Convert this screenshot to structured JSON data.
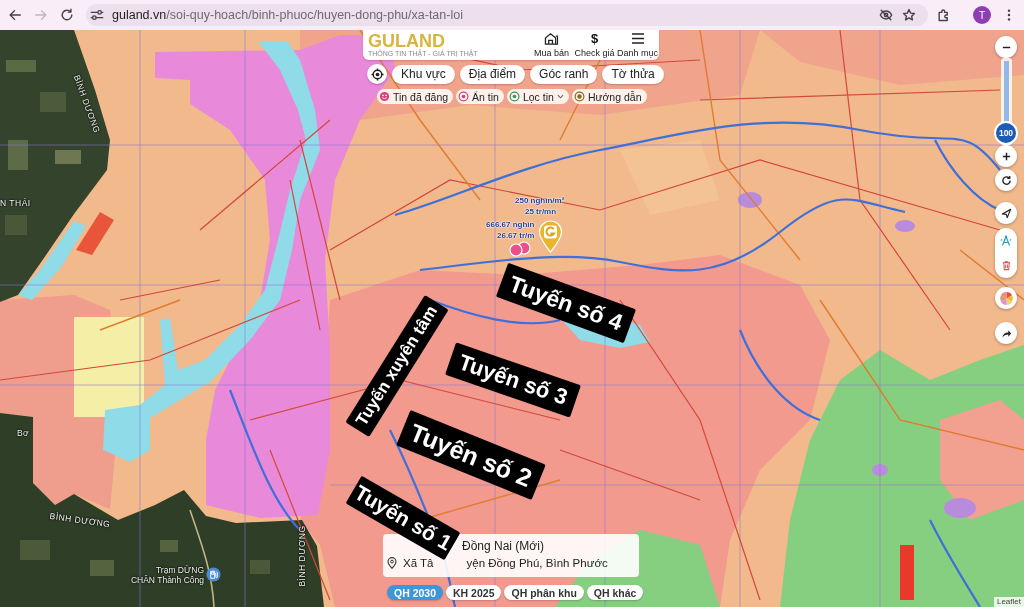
{
  "browser": {
    "url": "guland.vn/soi-quy-hoach/binh-phuoc/huyen-dong-phu/xa-tan-loi",
    "forward_disabled": true,
    "profile_initial": "T"
  },
  "header": {
    "logo": "GULAND",
    "slogan": "THÔNG TIN THẬT - GIÁ TRỊ THẬT",
    "nav": [
      {
        "kind": "house",
        "label": "Mua bán"
      },
      {
        "kind": "symbol",
        "symbol": "$",
        "label": "Check giá"
      },
      {
        "kind": "menu",
        "label": "Danh mục"
      }
    ]
  },
  "search_modes": [
    "Khu vực",
    "Địa điểm",
    "Góc ranh",
    "Tờ thửa"
  ],
  "post_filters": [
    {
      "kind": "posted",
      "label": "Tin đã đăng"
    },
    {
      "kind": "hidden",
      "label": "Ẩn tin"
    },
    {
      "kind": "filter",
      "label": "Lọc tin",
      "dropdown": true
    },
    {
      "kind": "guide",
      "label": "Hướng dẫn"
    }
  ],
  "zoom": {
    "level": 1,
    "reading": "100"
  },
  "map": {
    "place_labels": [
      "BÌNH DƯƠNG",
      "N THÁI",
      "Bơ",
      "BÌNH DƯƠNG",
      "BÌNH DƯƠNG"
    ],
    "station": {
      "lines": [
        "Trạm DỪNG",
        "CHÂN Thành Công"
      ]
    },
    "price_labels": [
      "250 nghìn/m²",
      "25 tr/mn",
      "666.67 nghìn",
      "26.67 tr/m"
    ],
    "routes": [
      "Tuyến số 4",
      "Tuyến số 3",
      "Tuyến số 2",
      "Tuyến số 1",
      "Tuyến xuyên tâm"
    ],
    "attribution": "Leaflet"
  },
  "location_card": {
    "province": "Đồng Nai (Mới)",
    "address_parts": [
      "Xã Tâ",
      "yện Đồng Phú, Bình Phước"
    ]
  },
  "plan_layers": [
    {
      "label": "QH 2030",
      "selected": true
    },
    {
      "label": "KH 2025",
      "selected": false
    },
    {
      "label": "QH phân khu",
      "selected": false
    },
    {
      "label": "QH khác",
      "selected": false
    }
  ]
}
